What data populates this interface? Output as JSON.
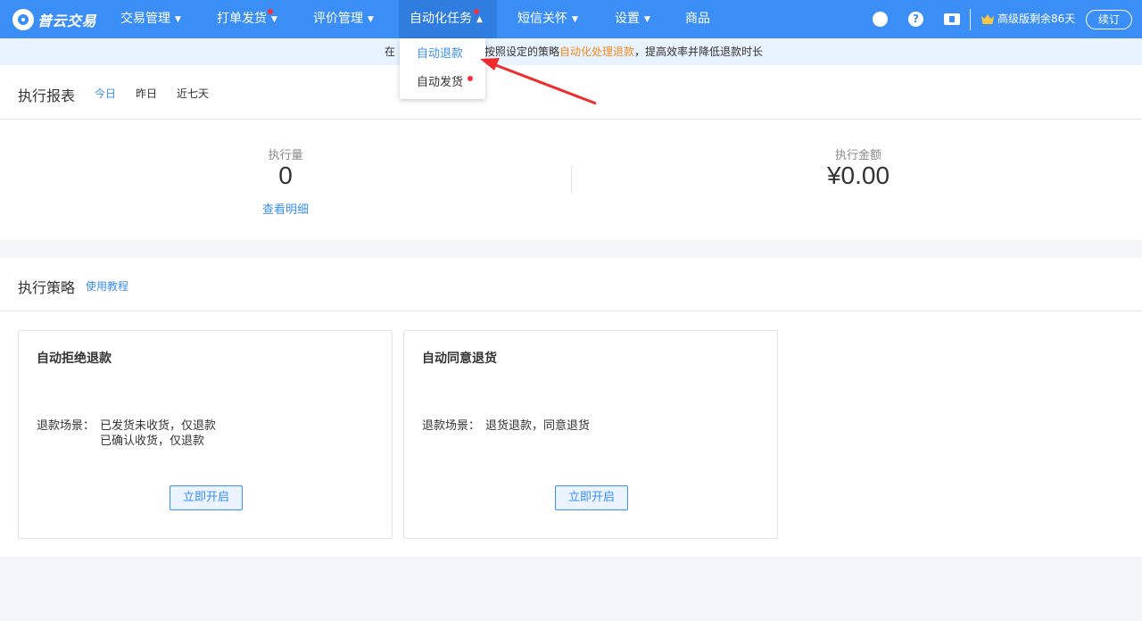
{
  "header": {
    "logo_text": "普云交易",
    "nav": [
      {
        "label": "交易管理",
        "chevron": "▼"
      },
      {
        "label": "打单发货",
        "chevron": "▼"
      },
      {
        "label": "评价管理",
        "chevron": "▼"
      },
      {
        "label": "自动化任务",
        "chevron": "▲"
      },
      {
        "label": "短信关怀",
        "chevron": "▼"
      },
      {
        "label": "设置",
        "chevron": "▼"
      },
      {
        "label": "商品"
      }
    ],
    "plan_text": "高级版剩余86天",
    "renew_label": "续订",
    "accent_color": "#3a8ef5"
  },
  "notice": {
    "prefix": "在",
    "middle": "按照设定的策略",
    "highlight": "自动化处理退款",
    "suffix": "，提高效率并降低退款时长",
    "highlight_color": "#f08a1d"
  },
  "dropdown": {
    "items": [
      {
        "label": "自动退款",
        "selected": true
      },
      {
        "label": "自动发货",
        "has_dot": true
      }
    ]
  },
  "report": {
    "title": "执行报表",
    "tabs": [
      "今日",
      "昨日",
      "近七天"
    ],
    "active_tab": "今日",
    "stats": [
      {
        "label": "执行量",
        "value": "0",
        "link": "查看明细"
      },
      {
        "label": "执行金额",
        "value": "¥0.00"
      }
    ]
  },
  "strategy": {
    "title": "执行策略",
    "tutorial_link": "使用教程",
    "cards": [
      {
        "title": "自动拒绝退款",
        "scene_label": "退款场景：",
        "scene_lines": [
          "已发货未收货，仅退款",
          "已确认收货，仅退款"
        ],
        "button": "立即开启"
      },
      {
        "title": "自动同意退货",
        "scene_label": "退款场景：",
        "scene_lines": [
          "退货退款，同意退货"
        ],
        "button": "立即开启"
      }
    ]
  },
  "icons": [
    "cloud-icon",
    "help-icon",
    "ticket-icon",
    "crown-icon",
    "red-arrow-annotation"
  ]
}
